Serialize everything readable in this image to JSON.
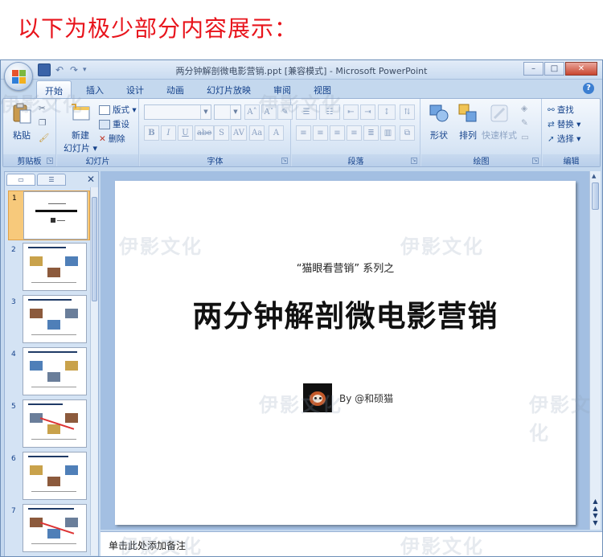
{
  "banner": "以下为极少部分内容展示：",
  "window": {
    "title": "两分钟解剖微电影营销.ppt [兼容模式] - Microsoft PowerPoint",
    "controls": [
      "–",
      "□",
      "✕"
    ]
  },
  "ribbon_tabs": [
    "开始",
    "插入",
    "设计",
    "动画",
    "幻灯片放映",
    "审阅",
    "视图"
  ],
  "groups": {
    "clipboard": {
      "label": "剪贴板",
      "paste": "粘贴"
    },
    "slides": {
      "label": "幻灯片",
      "new_slide_1": "新建",
      "new_slide_2": "幻灯片 ▾",
      "layout": "版式 ▾",
      "reset": "重设",
      "delete": "删除"
    },
    "font": {
      "label": "字体"
    },
    "paragraph": {
      "label": "段落"
    },
    "drawing": {
      "label": "绘图",
      "shapes": "形状",
      "arrange": "排列",
      "quick_styles": "快速样式"
    },
    "editing": {
      "label": "编辑",
      "find": "查找",
      "replace": "替换 ▾",
      "select": "选择 ▾"
    }
  },
  "slides_count": 7,
  "slide": {
    "subtitle": "“猫眼看营销” 系列之",
    "title": "两分钟解剖微电影营销",
    "author": "By @和硕猫"
  },
  "notes_placeholder": "单击此处添加备注",
  "watermark": "伊影文化",
  "colors": {
    "banner": "#e8141c",
    "accent": "#15428b",
    "selected_thumb": "#f7c97b"
  }
}
